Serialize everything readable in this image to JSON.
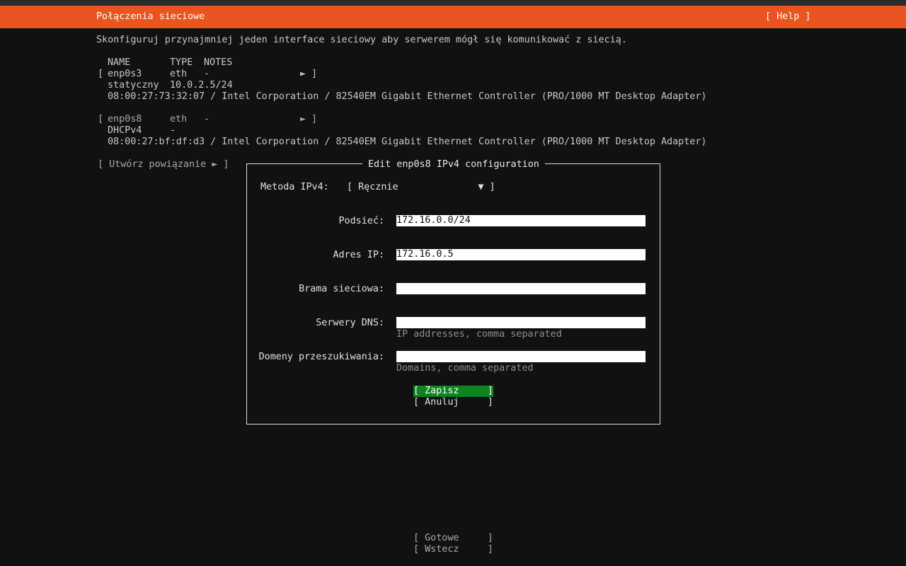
{
  "header": {
    "title": "Połączenia sieciowe",
    "help": "[ Help ]"
  },
  "intro": "Skonfiguruj przynajmniej jeden interface sieciowy aby serwerem mógł się komunikować z siecią.",
  "table": {
    "headers": {
      "name": "NAME",
      "type": "TYPE",
      "notes": "NOTES"
    },
    "interfaces": [
      {
        "open": "[",
        "name": "enp0s3",
        "type": "eth",
        "notes": "-",
        "arrow": "►",
        "close": "]",
        "method": "statyczny",
        "address": "10.0.2.5/24",
        "hw": "08:00:27:73:32:07 / Intel Corporation / 82540EM Gigabit Ethernet Controller (PRO/1000 MT Desktop Adapter)"
      },
      {
        "open": "[",
        "name": "enp0s8",
        "type": "eth",
        "notes": "-",
        "arrow": "►",
        "close": "]",
        "method": "DHCPv4",
        "address": "-",
        "hw": "08:00:27:bf:df:d3 / Intel Corporation / 82540EM Gigabit Ethernet Controller (PRO/1000 MT Desktop Adapter)"
      }
    ],
    "create_bond": "[ Utwórz powiązanie ► ]"
  },
  "dialog": {
    "title": "Edit enp0s8 IPv4 configuration",
    "method_label": "Metoda IPv4:",
    "method_value": "[ Ręcznie              ▼ ]",
    "subnet_label": "Podsieć:",
    "subnet_value": "172.16.0.0/24",
    "address_label": "Adres IP:",
    "address_value": "172.16.0.5",
    "gateway_label": "Brama sieciowa:",
    "gateway_value": "",
    "dns_label": "Serwery DNS:",
    "dns_value": "",
    "dns_hint": "IP addresses, comma separated",
    "search_label": "Domeny przeszukiwania:",
    "search_value": "",
    "search_hint": "Domains, comma separated",
    "save": "[ Zapisz     ]",
    "cancel": "[ Anuluj     ]"
  },
  "footer": {
    "done": "[ Gotowe     ]",
    "back": "[ Wstecz     ]"
  },
  "colors": {
    "accent": "#e95420",
    "selected": "#0e8420",
    "background": "#111111"
  }
}
